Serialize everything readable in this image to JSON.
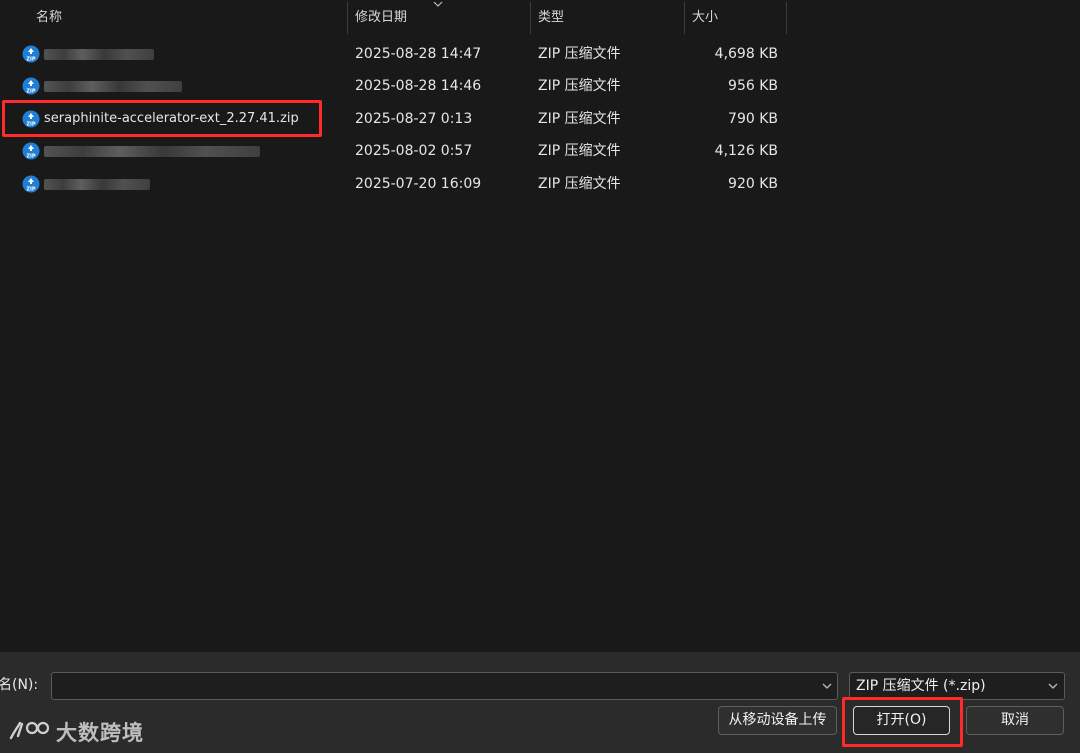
{
  "columns": {
    "name": "名称",
    "date": "修改日期",
    "type": "类型",
    "size": "大小"
  },
  "files": [
    {
      "name": "",
      "date": "2025-08-28 14:47",
      "type": "ZIP 压缩文件",
      "size": "4,698 KB",
      "redacted": true
    },
    {
      "name": "",
      "date": "2025-08-28 14:46",
      "type": "ZIP 压缩文件",
      "size": "956 KB",
      "redacted": true
    },
    {
      "name": "seraphinite-accelerator-ext_2.27.41.zip",
      "date": "2025-08-27 0:13",
      "type": "ZIP 压缩文件",
      "size": "790 KB",
      "redacted": false,
      "highlighted": true
    },
    {
      "name": "",
      "date": "2025-08-02 0:57",
      "type": "ZIP 压缩文件",
      "size": "4,126 KB",
      "redacted": true
    },
    {
      "name": "",
      "date": "2025-07-20 16:09",
      "type": "ZIP 压缩文件",
      "size": "920 KB",
      "redacted": true
    }
  ],
  "bottom": {
    "filename_label": "名(N):",
    "filename_value": "",
    "filetype_selected": "ZIP 压缩文件 (*.zip)",
    "mobile_button": "从移动设备上传",
    "open_button": "打开(O)",
    "cancel_button": "取消"
  },
  "watermark": {
    "text": "大数跨境"
  },
  "colors": {
    "background": "#191919",
    "bottom_bar": "#2b2b2b",
    "highlight": "#ff2a2a",
    "zip_icon": "#1f7fd6"
  }
}
